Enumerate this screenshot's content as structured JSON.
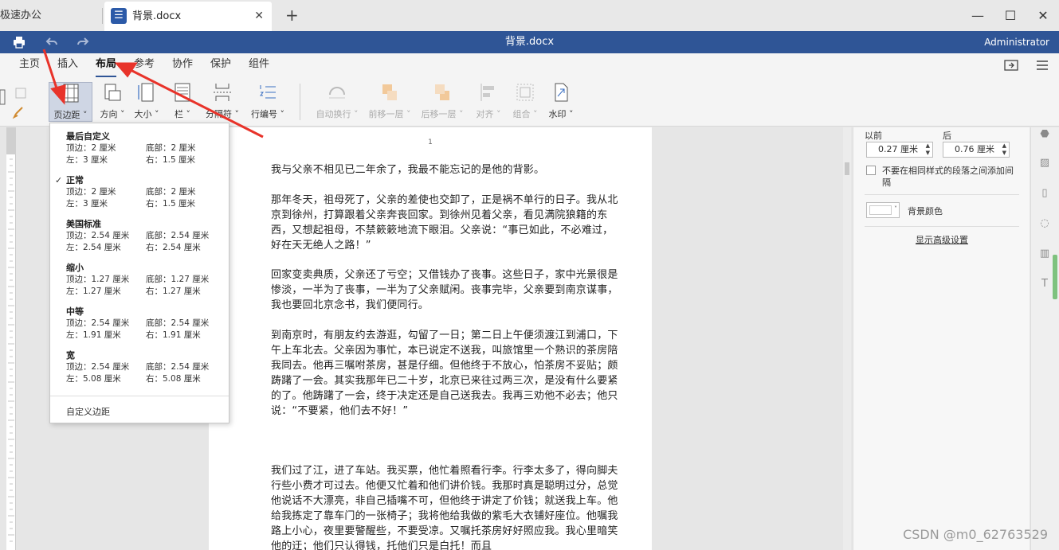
{
  "tabs": {
    "app_label": "极速办公",
    "doc_title": "背景.docx",
    "new_tab": "+",
    "close": "✕"
  },
  "window": {
    "minimize": "—",
    "maximize": "☐",
    "close": "✕"
  },
  "titlebar": {
    "doc_title": "背景.docx",
    "user": "Administrator"
  },
  "menu": {
    "items": [
      "主页",
      "插入",
      "布局",
      "参考",
      "协作",
      "保护",
      "组件"
    ],
    "active": "布局"
  },
  "ribbon": {
    "margins": "页边距",
    "orientation": "方向",
    "size": "大小",
    "columns": "栏",
    "breaks": "分隔符",
    "line_numbers": "行编号",
    "wrap": "自动换行",
    "bring_forward": "前移一层",
    "send_backward": "后移一层",
    "align": "对齐",
    "group": "组合",
    "watermark": "水印"
  },
  "margins_menu": {
    "groups": [
      {
        "title": "最后自定义",
        "top": "顶边：2 厘米",
        "bottom": "底部：2 厘米",
        "left": "左：3 厘米",
        "right": "右：1.5 厘米",
        "checked": false
      },
      {
        "title": "正常",
        "top": "顶边：2 厘米",
        "bottom": "底部：2 厘米",
        "left": "左：3 厘米",
        "right": "右：1.5 厘米",
        "checked": true
      },
      {
        "title": "美国标准",
        "top": "顶边：2.54 厘米",
        "bottom": "底部：2.54 厘米",
        "left": "左：2.54 厘米",
        "right": "右：2.54 厘米",
        "checked": false
      },
      {
        "title": "缩小",
        "top": "顶边：1.27 厘米",
        "bottom": "底部：1.27 厘米",
        "left": "左：1.27 厘米",
        "right": "右：1.27 厘米",
        "checked": false
      },
      {
        "title": "中等",
        "top": "顶边：2.54 厘米",
        "bottom": "底部：2.54 厘米",
        "left": "左：1.91 厘米",
        "right": "右：1.91 厘米",
        "checked": false
      },
      {
        "title": "宽",
        "top": "顶边：2.54 厘米",
        "bottom": "底部：2.54 厘米",
        "left": "左：5.08 厘米",
        "right": "右：5.08 厘米",
        "checked": false
      }
    ],
    "check_mark": "✓",
    "custom": "自定义边距"
  },
  "document": {
    "page_number": "1",
    "paragraphs": [
      "我与父亲不相见已二年余了，我最不能忘记的是他的背影。",
      "那年冬天，祖母死了，父亲的差使也交卸了，正是祸不单行的日子。我从北京到徐州，打算跟着父亲奔丧回家。到徐州见着父亲，看见满院狼籍的东西，又想起祖母，不禁簌簌地流下眼泪。父亲说：“事已如此，不必难过，好在天无绝人之路！”",
      "回家变卖典质，父亲还了亏空；又借钱办了丧事。这些日子，家中光景很是惨淡，一半为了丧事，一半为了父亲赋闲。丧事完毕，父亲要到南京谋事，我也要回北京念书，我们便同行。",
      "到南京时，有朋友约去游逛，勾留了一日；第二日上午便须渡江到浦口，下午上车北去。父亲因为事忙，本已说定不送我，叫旅馆里一个熟识的茶房陪我同去。他再三嘱咐茶房，甚是仔细。但他终于不放心，怕茶房不妥贴；颇踌躇了一会。其实我那年已二十岁，北京已来往过两三次，是没有什么要紧的了。他踌躇了一会，终于决定还是自己送我去。我再三劝他不必去；他只说：“不要紧，他们去不好！”",
      "我们过了江，进了车站。我买票，他忙着照看行李。行李太多了，得向脚夫行些小费才可过去。他便又忙着和他们讲价钱。我那时真是聪明过分，总觉他说话不大漂亮，非自己插嘴不可，但他终于讲定了价钱；就送我上车。他给我拣定了靠车门的一张椅子；我将他给我做的紫毛大衣铺好座位。他嘱我路上小心，夜里要警醒些，不要受凉。又嘱托茶房好好照应我。我心里暗笑他的迂；他们只认得钱，托他们只是白托！而且"
    ]
  },
  "right_panel": {
    "before_label": "以前",
    "after_label": "后",
    "before_value": "0.27 厘米",
    "after_value": "0.76 厘米",
    "no_space_label": "不要在相同样式的段落之间添加间隔",
    "bg_color_label": "背景颜色",
    "advanced_link": "显示高级设置"
  },
  "watermark_text": "CSDN @m0_62763529",
  "colors": {
    "titlebar": "#2f5596",
    "annotation_arrow": "#e8332a"
  }
}
